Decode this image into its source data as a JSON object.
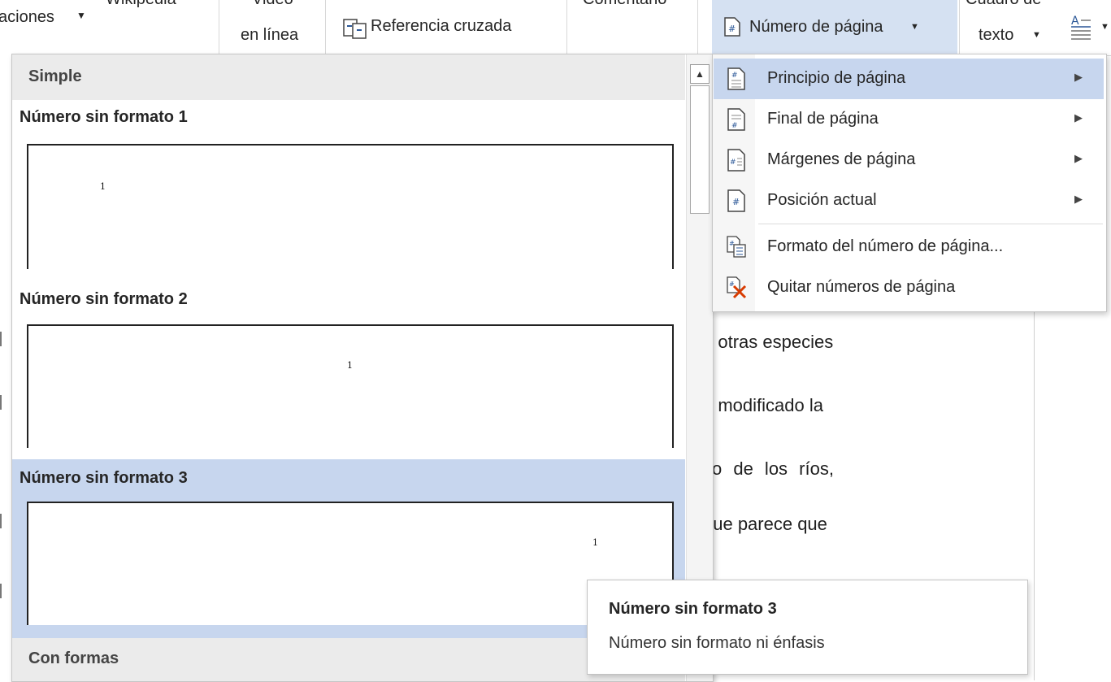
{
  "ribbon": {
    "citations": "aciones",
    "wikipedia": "Wikipedia",
    "video_l1": "Video",
    "video_l2": "en línea",
    "crossref": "Referencia cruzada",
    "comment": "Comentario",
    "page_number": "Número de página",
    "textbox_l1": "Cuadro de",
    "textbox_l2": "texto"
  },
  "gallery": {
    "section_simple": "Simple",
    "section_shapes": "Con formas",
    "items": [
      {
        "title": "Número sin formato 1",
        "number": "1"
      },
      {
        "title": "Número sin formato 2",
        "number": "1"
      },
      {
        "title": "Número sin formato 3",
        "number": "1"
      }
    ]
  },
  "menu": {
    "items": [
      {
        "label": "Principio de página",
        "icon": "page-top-icon"
      },
      {
        "label": "Final de página",
        "icon": "page-bottom-icon"
      },
      {
        "label": "Márgenes de página",
        "icon": "page-margins-icon"
      },
      {
        "label": "Posición actual",
        "icon": "current-position-icon"
      },
      {
        "label": "Formato del número de página...",
        "icon": "format-page-number-icon"
      },
      {
        "label": "Quitar números de página",
        "icon": "remove-page-numbers-icon"
      }
    ]
  },
  "tooltip": {
    "title": "Número sin formato 3",
    "description": "Número sin formato ni énfasis"
  },
  "document": {
    "lines": [
      "a otras especies",
      "a modificado la",
      "so de los ríos,",
      "que parece que"
    ]
  },
  "colors": {
    "highlight": "#c7d6ee",
    "ribbon_active": "#d5e1f2",
    "header_band": "#ebebeb"
  }
}
